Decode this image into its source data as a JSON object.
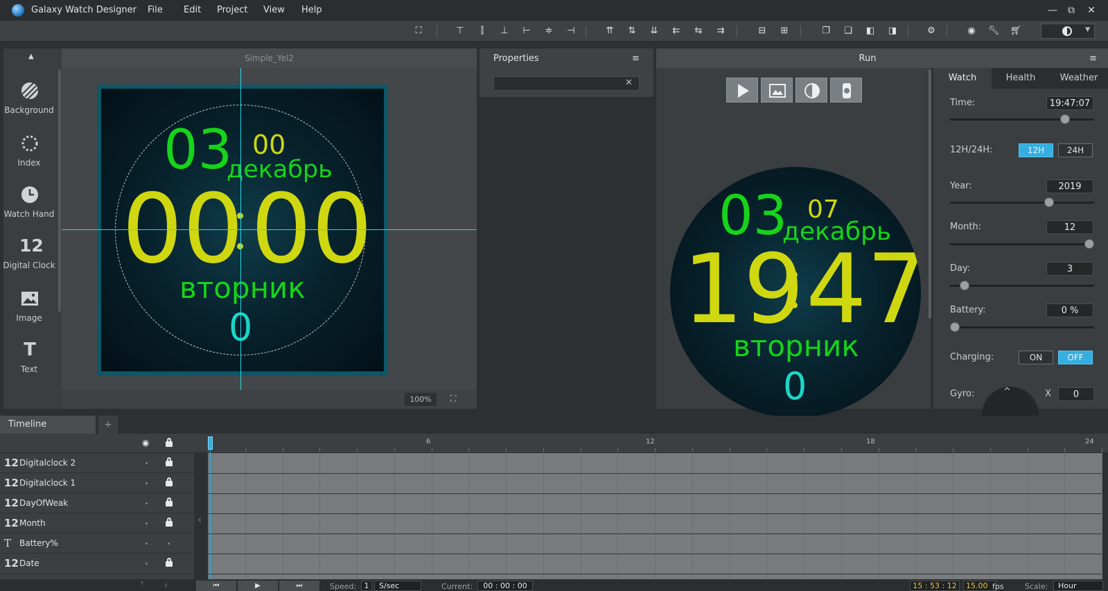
{
  "app": {
    "title": "Galaxy Watch Designer"
  },
  "menu": [
    "File",
    "Edit",
    "Project",
    "View",
    "Help"
  ],
  "window_controls": {
    "minimize": "—",
    "restore": "⧉",
    "close": "✕"
  },
  "toolbar": {
    "icons": [
      "fit-screen",
      "align-top",
      "align-middle",
      "align-bottom",
      "align-left",
      "align-center",
      "align-right",
      "distribute-top",
      "distribute-vcenter",
      "distribute-bottom",
      "distribute-left",
      "distribute-hcenter",
      "distribute-right",
      "same-width",
      "same-height",
      "group",
      "ungroup",
      "bring-front",
      "send-back",
      "build",
      "preview",
      "wrench",
      "cart",
      "theme"
    ]
  },
  "tools": [
    {
      "label": "Background",
      "icon": "background-icon"
    },
    {
      "label": "Index",
      "icon": "index-icon"
    },
    {
      "label": "Watch Hand",
      "icon": "watch-hand-icon"
    },
    {
      "label": "Digital Clock",
      "icon": "digital-clock-icon",
      "glyph": "12"
    },
    {
      "label": "Image",
      "icon": "image-icon"
    },
    {
      "label": "Text",
      "icon": "text-icon",
      "glyph": "T"
    }
  ],
  "canvas": {
    "title": "Simple_Yel2",
    "zoom": "100%",
    "face": {
      "day": "03",
      "seconds": "00",
      "month": "декабрь",
      "time_h": "00",
      "time_m": "00",
      "weekday": "вторник",
      "battery": "0"
    }
  },
  "properties": {
    "title": "Properties",
    "search_value": "",
    "clear": "✕"
  },
  "run": {
    "title": "Run",
    "face": {
      "day": "03",
      "seconds": "07",
      "month": "декабрь",
      "time_h": "19",
      "time_m": "47",
      "weekday": "вторник",
      "battery": "0"
    }
  },
  "sim": {
    "tabs": [
      "Watch",
      "Health",
      "Weather"
    ],
    "active_tab": "Watch",
    "time_label": "Time:",
    "time_value": "19:47:07",
    "mode_label": "12H/24H:",
    "mode_12": "12H",
    "mode_24": "24H",
    "mode_selected": "12H",
    "year_label": "Year:",
    "year_value": "2019",
    "month_label": "Month:",
    "month_value": "12",
    "day_label": "Day:",
    "day_value": "3",
    "battery_label": "Battery:",
    "battery_value": "0 %",
    "charging_label": "Charging:",
    "charging_on": "ON",
    "charging_off": "OFF",
    "charging_selected": "OFF",
    "gyro_label": "Gyro:",
    "gyro_axis": "X",
    "gyro_value": "0",
    "sliders": {
      "time": 0.82,
      "year": 0.7,
      "month": 1.0,
      "day": 0.07,
      "battery": 0.0
    }
  },
  "timeline": {
    "tab": "Timeline",
    "add": "+",
    "layers": [
      {
        "icon": "12",
        "name": "Digitalclock 2",
        "locked": true
      },
      {
        "icon": "12",
        "name": "Digitalclock 1",
        "locked": true
      },
      {
        "icon": "12",
        "name": "DayOfWeak",
        "locked": true
      },
      {
        "icon": "12",
        "name": "Month",
        "locked": true
      },
      {
        "icon": "T",
        "name": "Battery%",
        "locked": false
      },
      {
        "icon": "12",
        "name": "Date",
        "locked": true
      }
    ],
    "ticks": [
      "6",
      "12",
      "18",
      "24"
    ]
  },
  "bottom": {
    "speed_label": "Speed:",
    "speed_value": "1",
    "speed_unit": "S/sec",
    "current_label": "Current:",
    "current_value": "00 : 00 : 00",
    "clock_value": "15 : 53 : 12",
    "fps_value": "15.00",
    "fps_unit": "fps",
    "scale_label": "Scale:",
    "scale_value": "Hour",
    "transport": [
      "⏮",
      "▶",
      "⏭"
    ]
  },
  "colors": {
    "accent": "#35aee0",
    "green": "#17d31a",
    "yellow": "#cfd711",
    "teal": "#1bd6c7"
  }
}
